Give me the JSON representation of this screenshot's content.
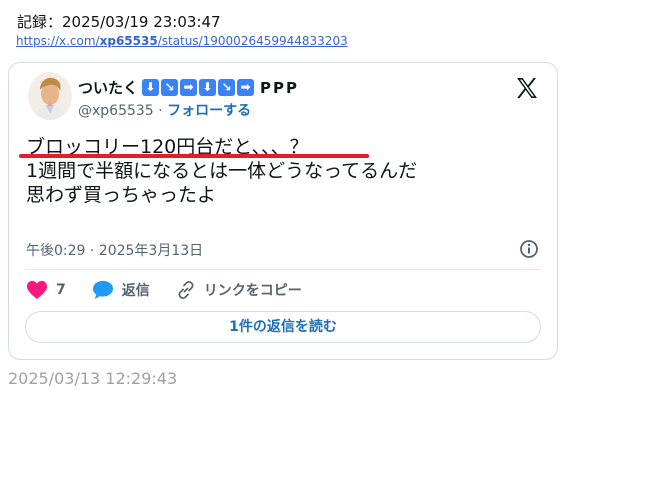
{
  "record": {
    "label": "記録：2025/03/19 23:03:47",
    "url_prefix": "https://x.com/",
    "url_user": "xp65535",
    "url_suffix": "/status/1900026459944833203"
  },
  "tweet": {
    "display_name": "ついたく",
    "name_suffix": "PPP",
    "arrow_icons": [
      "arrow-down-icon",
      "arrow-down-right-icon",
      "arrow-right-icon",
      "arrow-down-icon",
      "arrow-down-right-icon",
      "arrow-right-icon"
    ],
    "handle": "@xp65535",
    "separator": "·",
    "follow_label": "フォローする",
    "text_lines": [
      "ブロッコリー120円台だと、、、？",
      "1週間で半額になるとは一体どうなってるんだ",
      "",
      "思わず買っちゃったよ"
    ],
    "timestamp": "午後0:29 · 2025年3月13日",
    "like_count": "7",
    "reply_label": "返信",
    "copy_link_label": "リンクをコピー",
    "read_replies_label": "1件の返信を読む",
    "accent_color": "#1d6fb8",
    "like_color": "#f91880",
    "highlight_color": "#e11d2e"
  },
  "footer": {
    "time": "2025/03/13 12:29:43"
  }
}
